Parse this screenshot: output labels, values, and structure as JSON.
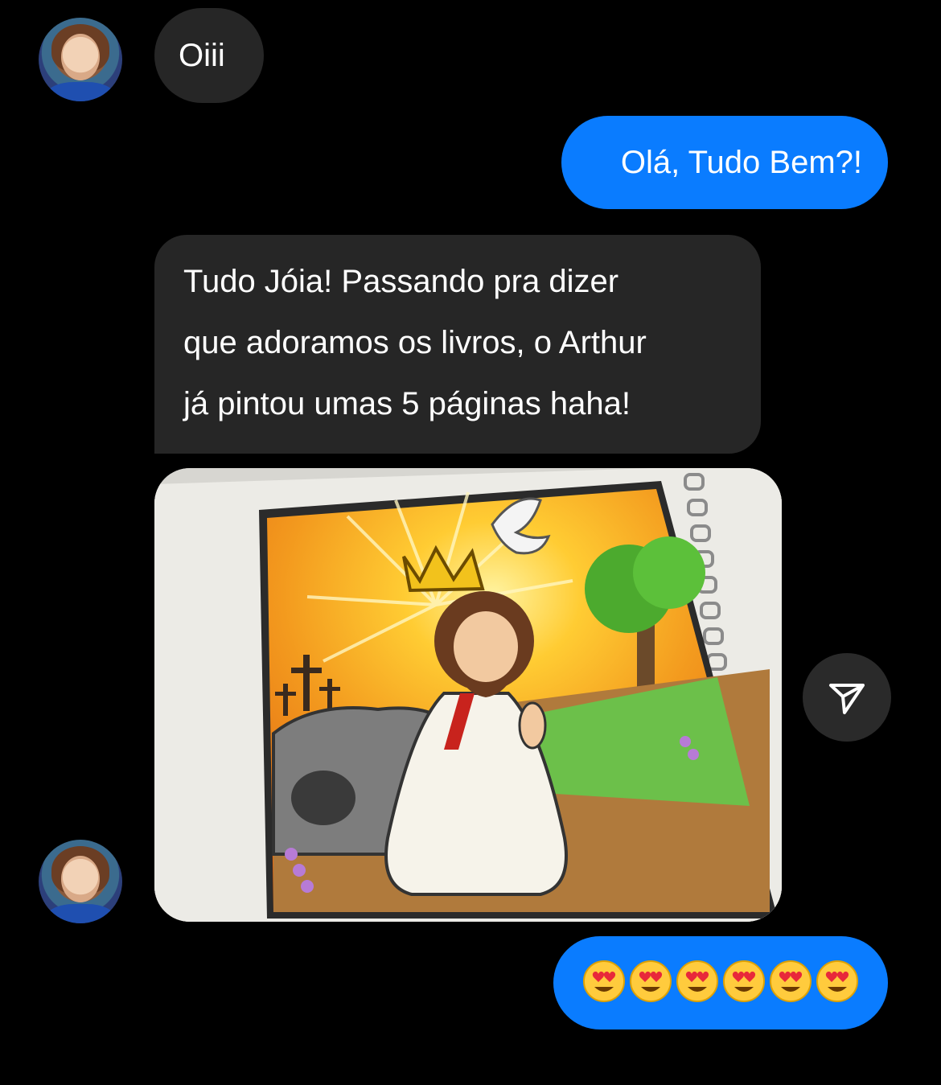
{
  "conversation": {
    "messages": [
      {
        "sender": "contact",
        "text": "Oiii"
      },
      {
        "sender": "me",
        "text": "Olá, Tudo Bem?!"
      },
      {
        "sender": "contact",
        "lines": [
          "Tudo Jóia! Passando pra dizer",
          "que adoramos os livros, o Arthur",
          "já pintou umas 5 páginas haha!"
        ]
      },
      {
        "sender": "contact",
        "type": "image",
        "description_icon": "photo-colored-page"
      },
      {
        "sender": "me",
        "emoji": [
          "😍",
          "😍",
          "😍",
          "😍",
          "😍",
          "😍"
        ]
      }
    ]
  },
  "colors": {
    "incoming_bubble": "#262626",
    "outgoing_bubble": "#0a7cff",
    "background": "#000000"
  },
  "icons": {
    "avatar": "avatar-icon",
    "share": "send-icon"
  }
}
